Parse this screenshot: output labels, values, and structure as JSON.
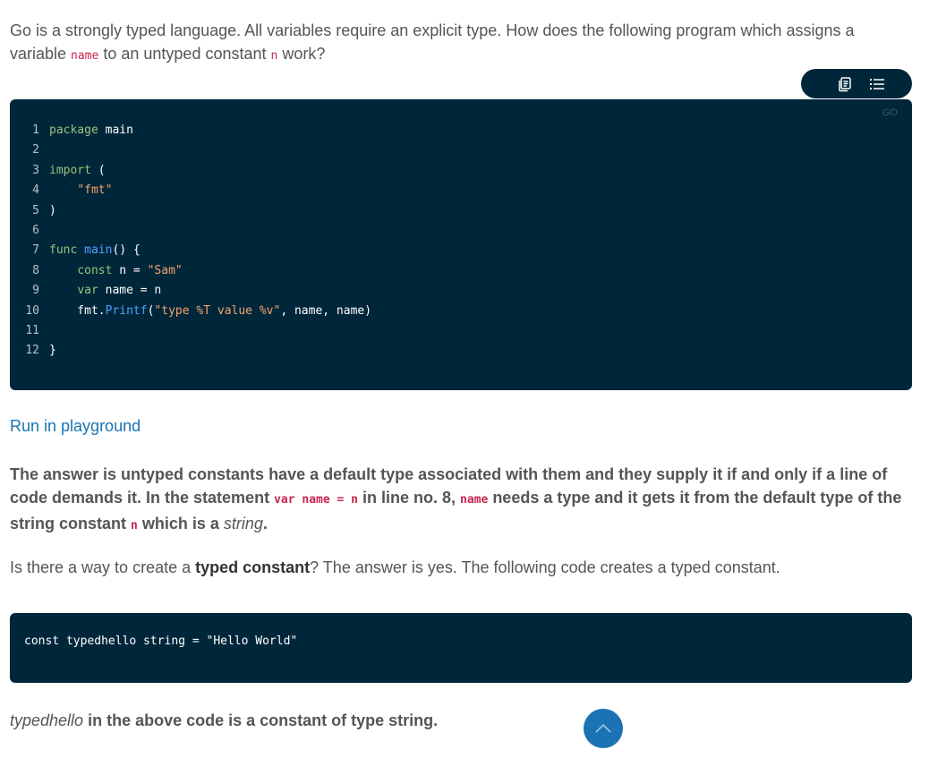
{
  "intro": {
    "text1": "Go is a strongly typed language. All variables require an explicit type. How does the following program which assigns a variable ",
    "code_name": "name",
    "text2": " to an untyped constant ",
    "code_n": "n",
    "text3": " work?"
  },
  "toolbar": {
    "copy_icon": "copy-icon",
    "list_icon": "list-icon"
  },
  "code1": {
    "lang": "GO",
    "lines": [
      {
        "num": "1",
        "segments": [
          {
            "t": "package",
            "c": "kw-green"
          },
          {
            "t": " main",
            "c": "pl"
          }
        ]
      },
      {
        "num": "2",
        "segments": []
      },
      {
        "num": "3",
        "segments": [
          {
            "t": "import",
            "c": "kw-green"
          },
          {
            "t": " (",
            "c": "pl"
          }
        ]
      },
      {
        "num": "4",
        "segments": [
          {
            "t": "    ",
            "c": "pl"
          },
          {
            "t": "\"fmt\"",
            "c": "str"
          }
        ]
      },
      {
        "num": "5",
        "segments": [
          {
            "t": ")",
            "c": "pl"
          }
        ]
      },
      {
        "num": "6",
        "segments": []
      },
      {
        "num": "7",
        "segments": [
          {
            "t": "func",
            "c": "kw-green"
          },
          {
            "t": " ",
            "c": "pl"
          },
          {
            "t": "main",
            "c": "fn"
          },
          {
            "t": "() {",
            "c": "pl"
          }
        ]
      },
      {
        "num": "8",
        "segments": [
          {
            "t": "    ",
            "c": "pl"
          },
          {
            "t": "const",
            "c": "kw-green"
          },
          {
            "t": " n = ",
            "c": "pl"
          },
          {
            "t": "\"Sam\"",
            "c": "str"
          }
        ]
      },
      {
        "num": "9",
        "segments": [
          {
            "t": "    ",
            "c": "pl"
          },
          {
            "t": "var",
            "c": "kw-green"
          },
          {
            "t": " name = n",
            "c": "pl"
          }
        ]
      },
      {
        "num": "10",
        "segments": [
          {
            "t": "    fmt.",
            "c": "pl"
          },
          {
            "t": "Printf",
            "c": "fn"
          },
          {
            "t": "(",
            "c": "pl"
          },
          {
            "t": "\"type %T value %v\"",
            "c": "str"
          },
          {
            "t": ", name, name)",
            "c": "pl"
          }
        ]
      },
      {
        "num": "11",
        "segments": []
      },
      {
        "num": "12",
        "segments": [
          {
            "t": "}",
            "c": "pl"
          }
        ]
      }
    ]
  },
  "run_link": "Run in playground",
  "answer": {
    "text1": "The answer is untyped constants have a default type associated with them and they supply it if and only if a line of code demands it. In the statement ",
    "code1": "var name = n",
    "text2": " in line no. 8, ",
    "code2": "name",
    "text3": " needs a type and it gets it from the default type of the string constant ",
    "code3": "n",
    "text4": " which is a ",
    "em": "string",
    "text5": "."
  },
  "typed_q": {
    "text1": "Is there a way to create a ",
    "bold": "typed constant",
    "text2": "? The answer is yes. The following code creates a typed constant."
  },
  "code2": {
    "line": "const typedhello string = \"Hello World\""
  },
  "final": {
    "em": "typedhello",
    "text": " in the above code is a constant of type string."
  },
  "scroll_top": {
    "icon": "chevron-up-icon"
  }
}
